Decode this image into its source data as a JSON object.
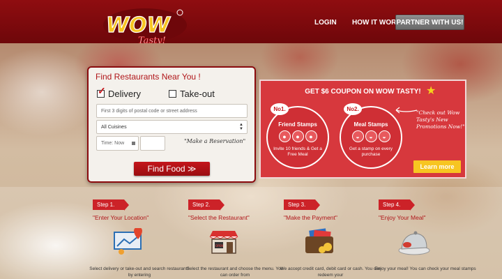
{
  "header": {
    "logo_text": "WOW",
    "logo_sub": "Tasty!",
    "nav": {
      "login": "LOGIN",
      "how_it_works": "HOW IT WORKS",
      "partner": "PARTNER WITH US!"
    }
  },
  "search": {
    "title": "Find Restaurants Near You !",
    "delivery_label": "Delivery",
    "delivery_checked": true,
    "takeout_label": "Take-out",
    "takeout_checked": false,
    "postal_placeholder": "First 3 digits of postal code or street address",
    "cuisine_value": "All Cuisines",
    "time_placeholder": "Time: Now",
    "reservation_note": "\"Make a Reservation\"",
    "find_button": "Find Food ≫"
  },
  "coupon": {
    "title": "GET $6 COUPON ON WOW TASTY!",
    "stamp1": {
      "badge": "No1.",
      "name": "Friend Stamps",
      "desc": "Invite 10 friends & Get a Free Meal"
    },
    "stamp2": {
      "badge": "No2.",
      "name": "Meal Stamps",
      "desc": "Get a stamp on every purchase"
    },
    "note": "\"Check out Wow Tasty's New Promotions Now!\"",
    "learn_more": "Learn more",
    "accent_color": "#d7383d",
    "button_color": "#f7c521"
  },
  "steps": [
    {
      "tag": "Step 1.",
      "title": "\"Enter Your Location\"",
      "text": "Select delivery or take-out and search restaurants by entering",
      "icon": "location-map-icon"
    },
    {
      "tag": "Step 2.",
      "title": "\"Select the Restaurant\"",
      "text": "Select the restaurant and choose the menu. You can order from",
      "icon": "restaurant-store-icon"
    },
    {
      "tag": "Step 3.",
      "title": "\"Make the Payment\"",
      "text": "We accept credit card, debit card or cash. You can redeem your",
      "icon": "wallet-payment-icon"
    },
    {
      "tag": "Step 4.",
      "title": "\"Enjoy Your Meal\"",
      "text": "Enjoy your meal! You can check your meal stamps",
      "icon": "food-cloche-icon"
    }
  ]
}
